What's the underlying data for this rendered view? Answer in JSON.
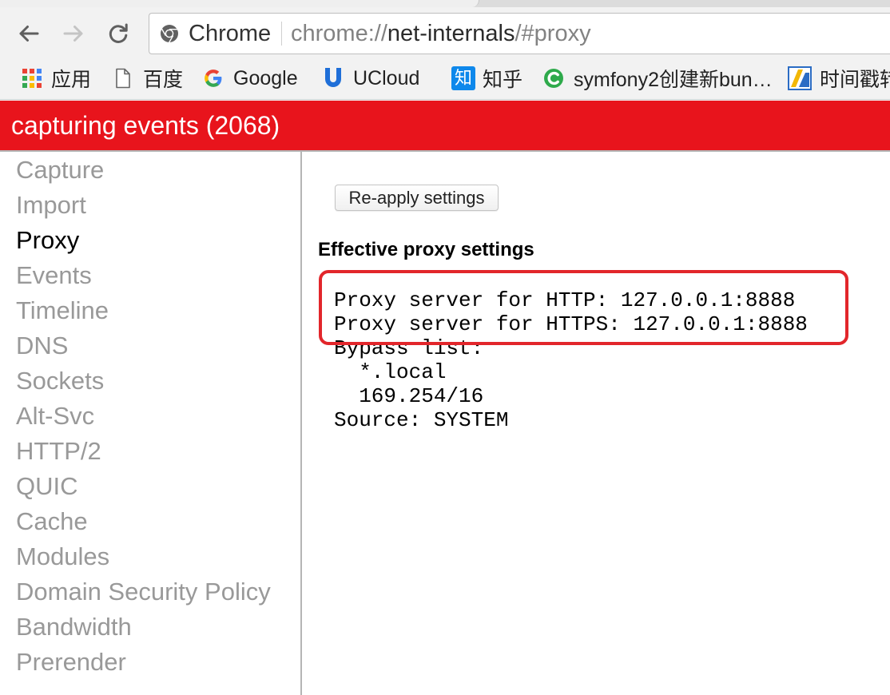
{
  "browser": {
    "nav": {
      "back_icon": "back-arrow-icon",
      "forward_icon": "forward-arrow-icon",
      "reload_icon": "reload-icon",
      "forward_enabled": false
    },
    "omnibox": {
      "site_icon": "chrome-logo-icon",
      "site_chip": "Chrome",
      "url_scheme": "chrome://",
      "url_host": "net-internals",
      "url_path": "/#proxy"
    },
    "bookmarks": [
      {
        "label": "应用",
        "icon": "apps-grid-icon"
      },
      {
        "label": "百度",
        "icon": "page-icon"
      },
      {
        "label": "Google",
        "icon": "google-icon"
      },
      {
        "label": "UCloud",
        "icon": "ucloud-icon"
      },
      {
        "label": "知乎",
        "icon": "zhihu-icon",
        "icon_glyph": "知"
      },
      {
        "label": "symfony2创建新bun…",
        "icon": "symfony-icon"
      },
      {
        "label": "时间戳转",
        "icon": "timestamp-icon"
      }
    ]
  },
  "status_bar": {
    "text": "capturing events (2068)"
  },
  "sidebar": {
    "items": [
      {
        "label": "Capture",
        "selected": false
      },
      {
        "label": "Import",
        "selected": false
      },
      {
        "label": "Proxy",
        "selected": true
      },
      {
        "label": "Events",
        "selected": false
      },
      {
        "label": "Timeline",
        "selected": false
      },
      {
        "label": "DNS",
        "selected": false
      },
      {
        "label": "Sockets",
        "selected": false
      },
      {
        "label": "Alt-Svc",
        "selected": false
      },
      {
        "label": "HTTP/2",
        "selected": false
      },
      {
        "label": "QUIC",
        "selected": false
      },
      {
        "label": "Cache",
        "selected": false
      },
      {
        "label": "Modules",
        "selected": false
      },
      {
        "label": "Domain Security Policy",
        "selected": false
      },
      {
        "label": "Bandwidth",
        "selected": false
      },
      {
        "label": "Prerender",
        "selected": false
      }
    ]
  },
  "proxy": {
    "reapply_button": "Re-apply settings",
    "effective": {
      "heading": "Effective proxy settings",
      "http": {
        "label": "Proxy server for HTTP:",
        "value": "127.0.0.1:8888"
      },
      "https": {
        "label": "Proxy server for HTTPS:",
        "value": "127.0.0.1:8888"
      },
      "bypass": {
        "label": "Bypass list:",
        "items": [
          "*.local",
          "169.254/16"
        ]
      },
      "source": {
        "label": "Source:",
        "value": "SYSTEM"
      }
    }
  },
  "colors": {
    "status_bar_bg": "#e8141c",
    "annotation_red": "#e2262b",
    "sidebar_inactive": "#999999",
    "sidebar_active": "#000000"
  }
}
